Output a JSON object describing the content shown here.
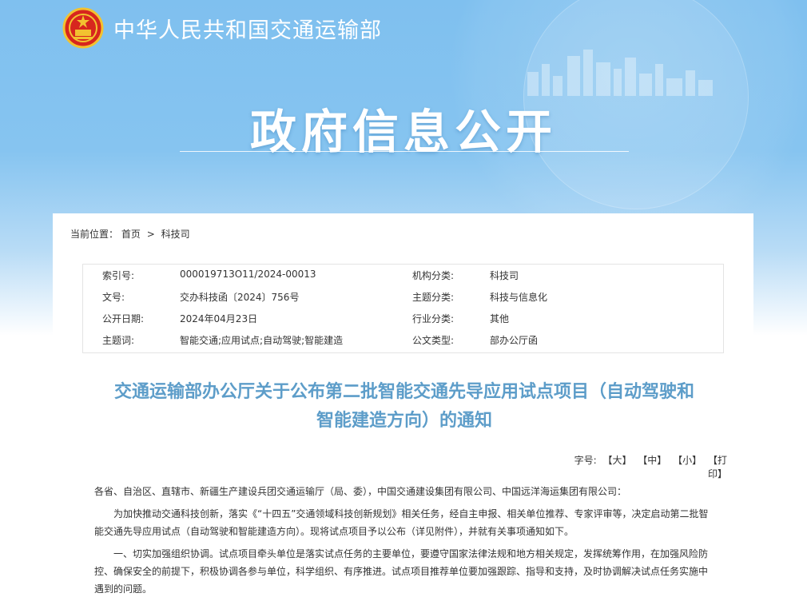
{
  "site": {
    "name": "中华人民共和国交通运输部",
    "hero_title": "政府信息公开"
  },
  "breadcrumb": {
    "label": "当前位置：",
    "items": [
      "首页",
      "科技司"
    ],
    "separator": ">"
  },
  "meta": {
    "rows": [
      {
        "k1": "索引号:",
        "v1": "000019713O11/2024-00013",
        "k2": "机构分类:",
        "v2": "科技司"
      },
      {
        "k1": "文号:",
        "v1": "交办科技函〔2024〕756号",
        "k2": "主题分类:",
        "v2": "科技与信息化"
      },
      {
        "k1": "公开日期:",
        "v1": "2024年04月23日",
        "k2": "行业分类:",
        "v2": "其他"
      },
      {
        "k1": "主题词:",
        "v1": "智能交通;应用试点;自动驾驶;智能建造",
        "k2": "公文类型:",
        "v2": "部办公厅函"
      }
    ]
  },
  "document": {
    "title_line1": "交通运输部办公厅关于公布第二批智能交通先导应用试点项目（自动驾驶和",
    "title_line2": "智能建造方向）的通知"
  },
  "font_size": {
    "label": "字号:",
    "large": "【大】",
    "medium": "【中】",
    "small": "【小】",
    "print": "【打印】"
  },
  "body": {
    "paragraphs": [
      "各省、自治区、直辖市、新疆生产建设兵团交通运输厅（局、委），中国交通建设集团有限公司、中国远洋海运集团有限公司：",
      "为加快推动交通科技创新，落实《“十四五”交通领域科技创新规划》相关任务，经自主申报、相关单位推荐、专家评审等，决定启动第二批智能交通先导应用试点（自动驾驶和智能建造方向）。现将试点项目予以公布（详见附件），并就有关事项通知如下。",
      "一、切实加强组织协调。试点项目牵头单位是落实试点任务的主要单位，要遵守国家法律法规和地方相关规定，发挥统筹作用，在加强风险防控、确保安全的前提下，积极协调各参与单位，科学组织、有序推进。试点项目推荐单位要加强跟踪、指导和支持，及时协调解决试点任务实施中遇到的问题。"
    ]
  },
  "colors": {
    "banner": "#7fc0ef",
    "doc_title": "#5d9dc9",
    "emblem_red": "#d7261e",
    "emblem_gold": "#f2c230"
  }
}
